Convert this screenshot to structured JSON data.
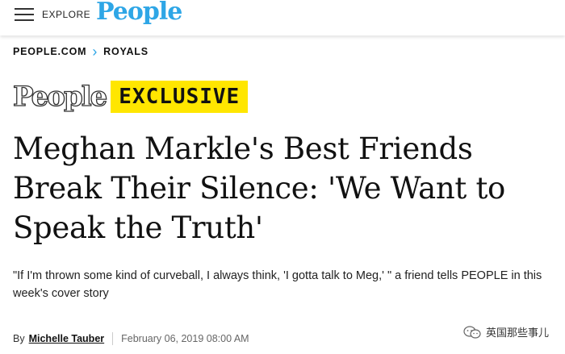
{
  "header": {
    "explore_label": "EXPLORE",
    "logo_text": "People",
    "logo_color": "#2ea6e6"
  },
  "breadcrumb": {
    "site": "PEOPLE.COM",
    "section": "ROYALS"
  },
  "exclusive": {
    "logo_text": "People",
    "badge_label": "EXCLUSIVE",
    "badge_color": "#ffe600"
  },
  "article": {
    "headline": "Meghan Markle's Best Friends Break Their Silence: 'We Want to Speak the Truth'",
    "dek": "\"If I'm thrown some kind of curveball, I always think, 'I gotta talk to Meg,' \" a friend tells PEOPLE in this week's cover story",
    "byline_prefix": "By",
    "author": "Michelle Tauber",
    "date": "February 06, 2019 08:00 AM"
  },
  "watermark": {
    "text": "英国那些事儿",
    "icon": "wechat-icon"
  }
}
